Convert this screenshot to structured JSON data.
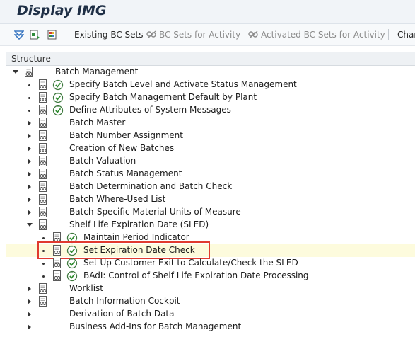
{
  "window": {
    "title": "Display IMG"
  },
  "toolbar": {
    "existing_bc_sets": "Existing BC Sets",
    "bc_sets_for_activity": "BC Sets for Activity",
    "activated_bc_sets_for_activity": "Activated BC Sets for Activity",
    "change_truncated": "Char"
  },
  "structure": {
    "header": "Structure",
    "root_label": "Batch Management",
    "items": [
      {
        "label": "Specify Batch Level and Activate Status Management"
      },
      {
        "label": "Specify Batch Management Default by Plant"
      },
      {
        "label": "Define Attributes of System Messages"
      },
      {
        "label": "Batch Master"
      },
      {
        "label": "Batch Number Assignment"
      },
      {
        "label": "Creation of New Batches"
      },
      {
        "label": "Batch Valuation"
      },
      {
        "label": "Batch Status Management"
      },
      {
        "label": "Batch Determination and Batch Check"
      },
      {
        "label": "Batch Where-Used List"
      },
      {
        "label": "Batch-Specific Material Units of Measure"
      },
      {
        "label": "Shelf Life Expiration Date (SLED)"
      },
      {
        "label": "Maintain Period Indicator"
      },
      {
        "label": "Set Expiration Date Check"
      },
      {
        "label": "Set Up Customer Exit to Calculate/Check the SLED"
      },
      {
        "label": "BAdI: Control of Shelf Life Expiration Date Processing"
      },
      {
        "label": "Worklist"
      },
      {
        "label": "Batch Information Cockpit"
      },
      {
        "label": "Derivation of Batch Data"
      },
      {
        "label": "Business Add-Ins for Batch Management"
      }
    ]
  },
  "icons": {
    "collapse_all": "collapse-all-icon",
    "documentation": "documentation-icon",
    "execute": "clock-execute-icon",
    "bc_set": "bc-set-icon"
  },
  "colors": {
    "highlight_row": "#fdfbdd",
    "annotation_box": "#e03a2f",
    "title_text": "#1f2f46"
  }
}
